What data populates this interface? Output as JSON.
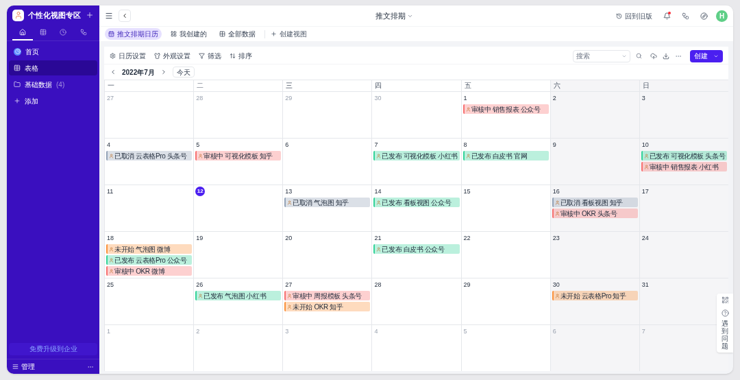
{
  "sidebar": {
    "title": "个性化视图专区",
    "tabs": [
      {
        "kind": "home",
        "selected": true
      },
      {
        "kind": "table",
        "selected": false
      },
      {
        "kind": "clock",
        "selected": false
      },
      {
        "kind": "flow",
        "selected": false
      }
    ],
    "items": [
      {
        "kind": "home",
        "label": "首页",
        "selected": false
      },
      {
        "kind": "table",
        "label": "表格",
        "selected": true
      },
      {
        "kind": "folder",
        "label": "基础数据",
        "count": "(4)",
        "selected": false
      },
      {
        "kind": "add",
        "label": "添加",
        "selected": false
      }
    ],
    "upgrade": "免费升级到企业",
    "manage": "管理"
  },
  "header": {
    "title": "推文排期",
    "old_version": "回到旧版",
    "avatar": "H"
  },
  "views": [
    {
      "label": "推文排期日历",
      "selected": true,
      "kind": "calendar"
    },
    {
      "label": "我创建的",
      "selected": false,
      "kind": "grid"
    },
    {
      "label": "全部数据",
      "selected": false,
      "kind": "board"
    }
  ],
  "create_view": "创建视图",
  "toolbar": {
    "actions": [
      {
        "kind": "settings",
        "label": "日历设置"
      },
      {
        "kind": "appearance",
        "label": "外观设置"
      },
      {
        "kind": "filter",
        "label": "筛选"
      },
      {
        "kind": "sort",
        "label": "排序"
      }
    ],
    "search_placeholder": "搜索",
    "create": "创建"
  },
  "calendar": {
    "month": "2022年7月",
    "today_button": "今天",
    "weekdays": [
      "一",
      "二",
      "三",
      "四",
      "五",
      "六",
      "日"
    ],
    "weeks": [
      [
        {
          "day": "27",
          "muted": true,
          "today": false
        },
        {
          "day": "28",
          "muted": true,
          "today": false
        },
        {
          "day": "29",
          "muted": true,
          "today": false
        },
        {
          "day": "30",
          "muted": true,
          "today": false
        },
        {
          "day": "1",
          "muted": false,
          "today": false,
          "events": [
            {
              "text": "审核中 销售报表 公众号",
              "color": "#f87171"
            }
          ]
        },
        {
          "day": "2",
          "muted": false,
          "today": false
        },
        {
          "day": "3",
          "muted": false,
          "today": false
        }
      ],
      [
        {
          "day": "4",
          "muted": false,
          "today": false,
          "events": [
            {
              "text": "已取消 云表格Pro 头条号",
              "color": "#94a3b8"
            }
          ]
        },
        {
          "day": "5",
          "muted": false,
          "today": false,
          "events": [
            {
              "text": "审核中 可视化模板 知乎",
              "color": "#f87171"
            }
          ]
        },
        {
          "day": "6",
          "muted": false,
          "today": false
        },
        {
          "day": "7",
          "muted": false,
          "today": false,
          "events": [
            {
              "text": "已发布 可视化模板 小红书",
              "color": "#34d399"
            }
          ]
        },
        {
          "day": "8",
          "muted": false,
          "today": false,
          "events": [
            {
              "text": "已发布 白皮书 官网",
              "color": "#34d399"
            }
          ]
        },
        {
          "day": "9",
          "muted": false,
          "today": false
        },
        {
          "day": "10",
          "muted": false,
          "today": false,
          "events": [
            {
              "text": "已发布 可视化模板 头条号",
              "color": "#34d399"
            },
            {
              "text": "审核中 销售报表 小红书",
              "color": "#f87171"
            }
          ]
        }
      ],
      [
        {
          "day": "11",
          "muted": false,
          "today": false
        },
        {
          "day": "12",
          "muted": false,
          "today": true
        },
        {
          "day": "13",
          "muted": false,
          "today": false,
          "events": [
            {
              "text": "已取消 气泡图 知乎",
              "color": "#94a3b8"
            }
          ]
        },
        {
          "day": "14",
          "muted": false,
          "today": false,
          "events": [
            {
              "text": "已发布 看板视图 公众号",
              "color": "#34d399"
            }
          ]
        },
        {
          "day": "15",
          "muted": false,
          "today": false
        },
        {
          "day": "16",
          "muted": false,
          "today": false,
          "events": [
            {
              "text": "已取消 看板视图 知乎",
              "color": "#94a3b8"
            },
            {
              "text": "审核中 OKR 头条号",
              "color": "#f87171"
            }
          ]
        },
        {
          "day": "17",
          "muted": false,
          "today": false
        }
      ],
      [
        {
          "day": "18",
          "muted": false,
          "today": false,
          "events": [
            {
              "text": "未开始 气泡图 微博",
              "color": "#fb923c"
            },
            {
              "text": "已发布 云表格Pro 公众号",
              "color": "#34d399"
            },
            {
              "text": "审核中 OKR 微博",
              "color": "#f87171"
            }
          ]
        },
        {
          "day": "19",
          "muted": false,
          "today": false
        },
        {
          "day": "20",
          "muted": false,
          "today": false
        },
        {
          "day": "21",
          "muted": false,
          "today": false,
          "events": [
            {
              "text": "已发布 白皮书 公众号",
              "color": "#34d399"
            }
          ]
        },
        {
          "day": "22",
          "muted": false,
          "today": false
        },
        {
          "day": "23",
          "muted": false,
          "today": false
        },
        {
          "day": "24",
          "muted": false,
          "today": false
        }
      ],
      [
        {
          "day": "25",
          "muted": false,
          "today": false
        },
        {
          "day": "26",
          "muted": false,
          "today": false,
          "events": [
            {
              "text": "已发布 气泡图 小红书",
              "color": "#34d399"
            }
          ]
        },
        {
          "day": "27",
          "muted": false,
          "today": false,
          "events": [
            {
              "text": "审核中 周报模板 头条号",
              "color": "#f87171"
            },
            {
              "text": "未开始 OKR 知乎",
              "color": "#fb923c"
            }
          ]
        },
        {
          "day": "28",
          "muted": false,
          "today": false
        },
        {
          "day": "29",
          "muted": false,
          "today": false
        },
        {
          "day": "30",
          "muted": false,
          "today": false,
          "events": [
            {
              "text": "未开始 云表格Pro 知乎",
              "color": "#fb923c"
            }
          ]
        },
        {
          "day": "31",
          "muted": false,
          "today": false
        }
      ],
      [
        {
          "day": "1",
          "muted": true,
          "today": false
        },
        {
          "day": "2",
          "muted": true,
          "today": false
        },
        {
          "day": "3",
          "muted": true,
          "today": false
        },
        {
          "day": "4",
          "muted": true,
          "today": false
        },
        {
          "day": "5",
          "muted": true,
          "today": false
        },
        {
          "day": "6",
          "muted": true,
          "today": false
        },
        {
          "day": "7",
          "muted": true,
          "today": false
        }
      ]
    ]
  },
  "help": "遇到问题"
}
